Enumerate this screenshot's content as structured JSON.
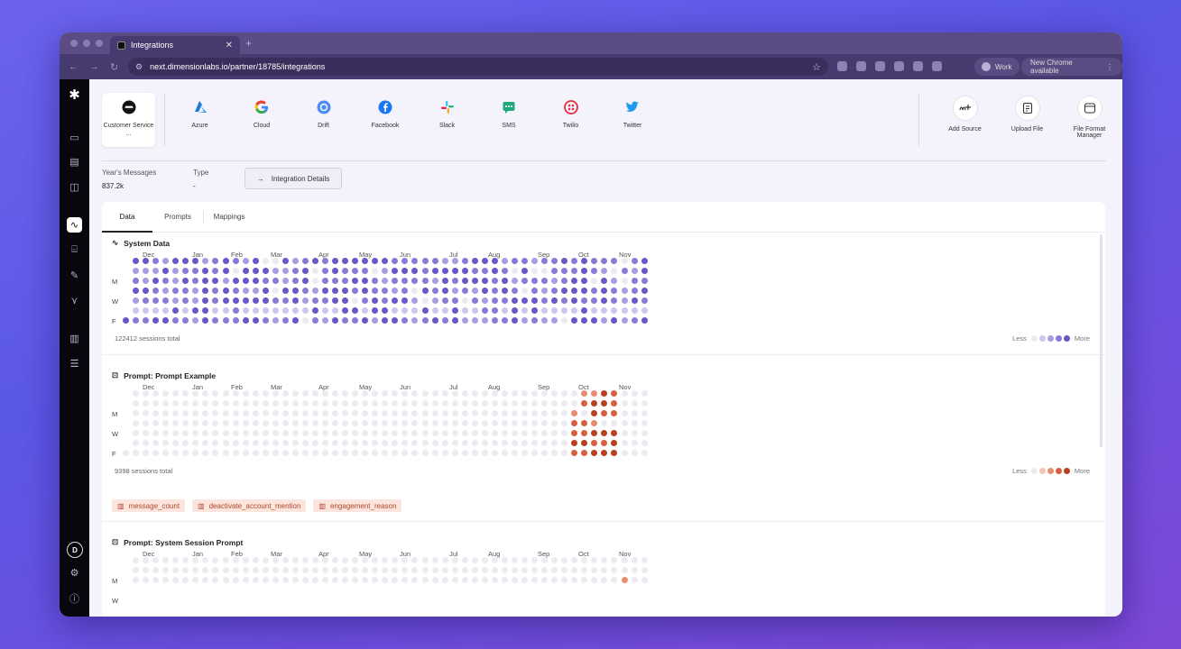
{
  "browser": {
    "tab_title": "Integrations",
    "new_tab_symbol": "+",
    "url": "next.dimensionlabs.io/partner/18785/integrations",
    "profile_label": "Work",
    "update_label": "New Chrome available"
  },
  "sources": [
    {
      "label": "Customer Service ...",
      "icon": "customer-service-icon",
      "selected": true
    },
    {
      "label": "Azure",
      "icon": "azure-icon"
    },
    {
      "label": "Cloud",
      "icon": "google-icon"
    },
    {
      "label": "Drift",
      "icon": "drift-icon"
    },
    {
      "label": "Facebook",
      "icon": "facebook-icon"
    },
    {
      "label": "Slack",
      "icon": "slack-icon"
    },
    {
      "label": "SMS",
      "icon": "sms-icon"
    },
    {
      "label": "Twilio",
      "icon": "twilio-icon"
    },
    {
      "label": "Twitter",
      "icon": "twitter-icon"
    }
  ],
  "actions": [
    {
      "label": "Add Source",
      "icon": "add-source-icon"
    },
    {
      "label": "Upload File",
      "icon": "upload-file-icon"
    },
    {
      "label": "File Format Manager",
      "icon": "file-format-icon"
    }
  ],
  "stats": {
    "messages_label": "Year's Messages",
    "messages_value": "837.2k",
    "type_label": "Type",
    "type_value": "-"
  },
  "details_button": "Integration Details",
  "tabs": [
    "Data",
    "Prompts",
    "Mappings"
  ],
  "months": [
    "Dec",
    "Jan",
    "Feb",
    "Mar",
    "Apr",
    "May",
    "Jun",
    "Jul",
    "Aug",
    "Sep",
    "Oct",
    "Nov"
  ],
  "days": [
    "M",
    "W",
    "F"
  ],
  "legend": {
    "less": "Less",
    "more": "More"
  },
  "sections": [
    {
      "title": "System Data",
      "total": "122412 sessions total",
      "palette": [
        "#ecebf1",
        "#cdc6ee",
        "#a99ce3",
        "#8b79d8",
        "#6a55c9"
      ],
      "activity": "high"
    },
    {
      "title": "Prompt: Prompt Example",
      "total": "9398 sessions total",
      "palette": [
        "#ecebf1",
        "#f1c5b7",
        "#e68c70",
        "#d6603f",
        "#b8401f"
      ],
      "activity": "oct",
      "chips": [
        "message_count",
        "deactivate_account_mention",
        "engagement_reason"
      ]
    },
    {
      "title": "Prompt: System Session Prompt",
      "palette": [
        "#ecebf1",
        "#f1c5b7",
        "#e68c70",
        "#d6603f",
        "#b8401f"
      ],
      "activity": "low"
    }
  ]
}
